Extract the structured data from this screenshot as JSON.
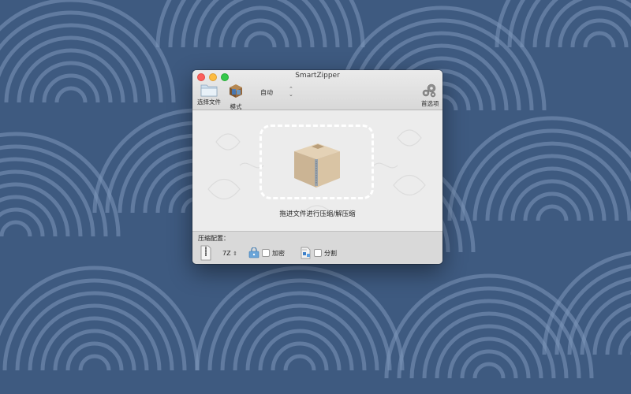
{
  "window": {
    "title": "SmartZipper"
  },
  "toolbar": {
    "choose_file_label": "选择文件",
    "mode_label": "模式",
    "mode_value": "自动",
    "preferences_label": "首选项"
  },
  "dropzone": {
    "hint": "拖进文件进行压缩/解压缩"
  },
  "settings": {
    "title": "压缩配置：",
    "format_value": "7Z",
    "encrypt_label": "加密",
    "split_label": "分割",
    "encrypt_checked": false,
    "split_checked": false
  },
  "colors": {
    "desktop_bg": "#3e5a80",
    "wallpaper_arcs": "#7d97ba",
    "close": "#fc605c",
    "minimize": "#fdbc40",
    "maximize": "#34c84a"
  },
  "icons": {
    "choose_file": "folder-icon",
    "mode": "package-icon",
    "preferences": "gears-icon",
    "format": "zip-file-icon",
    "encrypt": "lock-icon",
    "split": "split-icon"
  }
}
